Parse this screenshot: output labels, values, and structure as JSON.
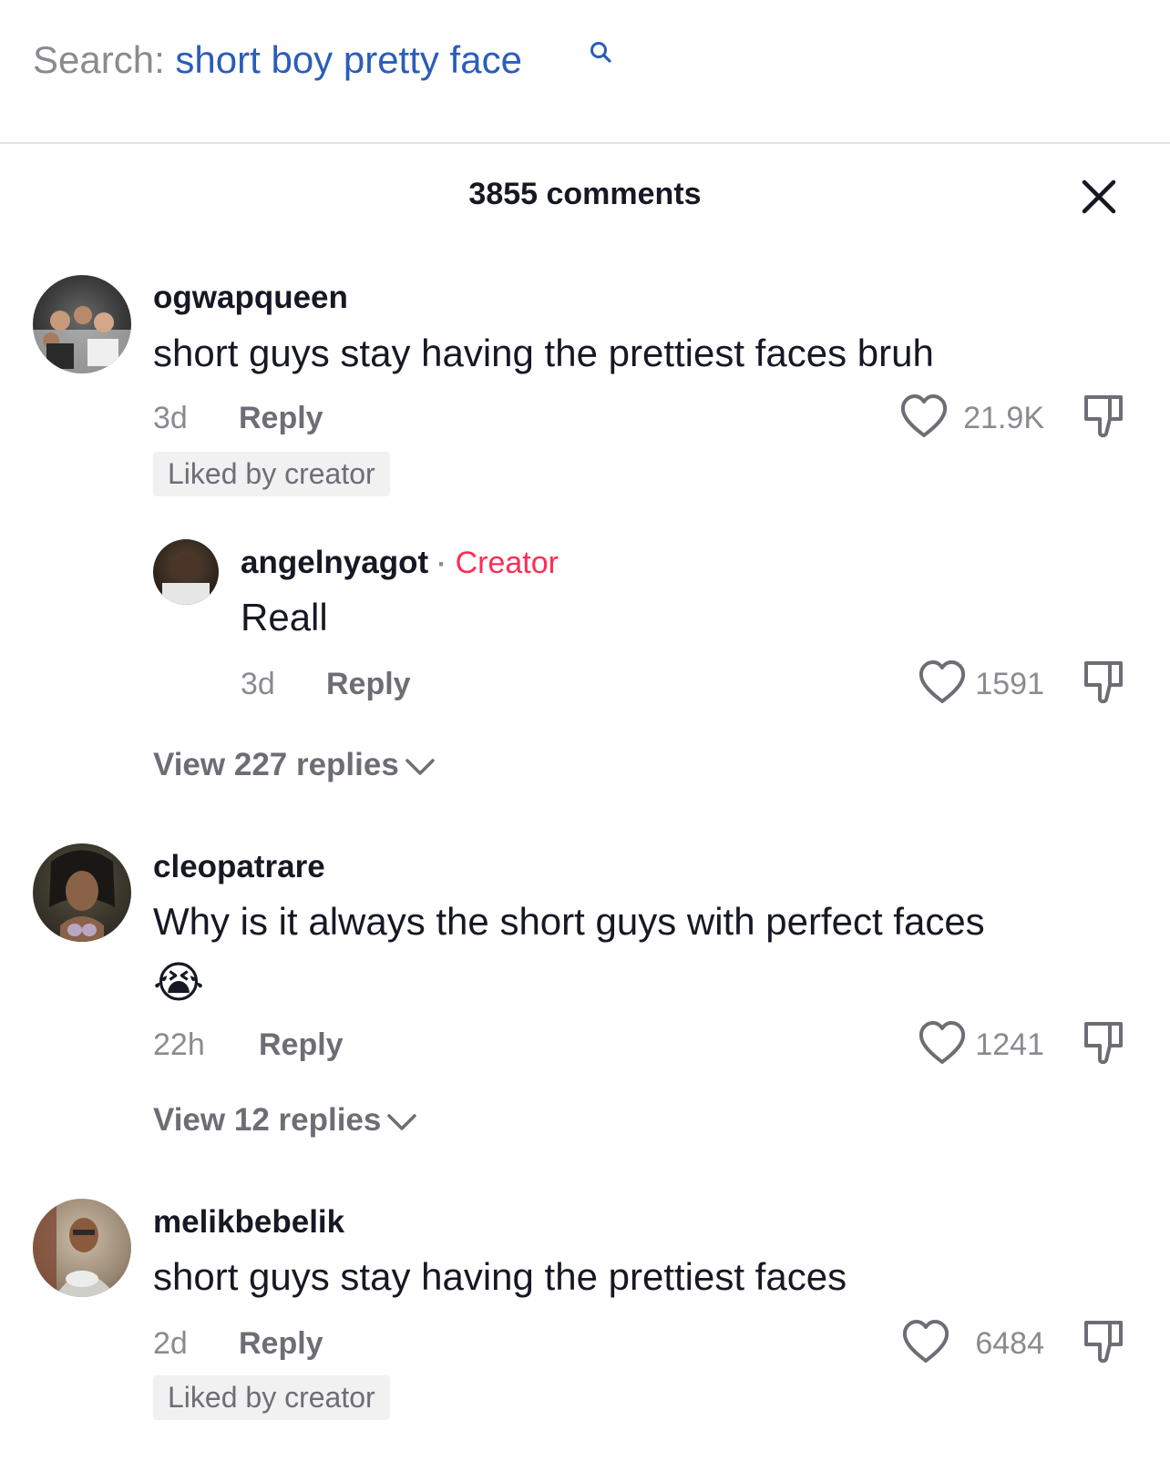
{
  "search": {
    "prefix": "Search:",
    "query": "short boy pretty face"
  },
  "header": {
    "title": "3855 comments"
  },
  "comments": [
    {
      "username": "ogwapqueen",
      "text": "short guys stay having the prettiest faces bruh",
      "time": "3d",
      "reply_label": "Reply",
      "likes": "21.9K",
      "badge": "Liked by creator",
      "reply": {
        "username": "angelnyagot",
        "separator": "·",
        "creator_label": "Creator",
        "text": "Reall",
        "time": "3d",
        "reply_label": "Reply",
        "likes": "1591"
      },
      "view_replies": "View 227 replies"
    },
    {
      "username": "cleopatrare",
      "text": "Why is it always the short guys with perfect faces",
      "emoji": "😭",
      "time": "22h",
      "reply_label": "Reply",
      "likes": "1241",
      "view_replies": "View 12 replies"
    },
    {
      "username": "melikbebelik",
      "text": "short guys stay having the prettiest faces",
      "time": "2d",
      "reply_label": "Reply",
      "likes": "6484",
      "badge": "Liked by creator"
    }
  ],
  "colors": {
    "accent_link": "#2b5db9",
    "creator_red": "#fe2c55",
    "text_primary": "#161823",
    "text_secondary": "#8a8b91"
  }
}
